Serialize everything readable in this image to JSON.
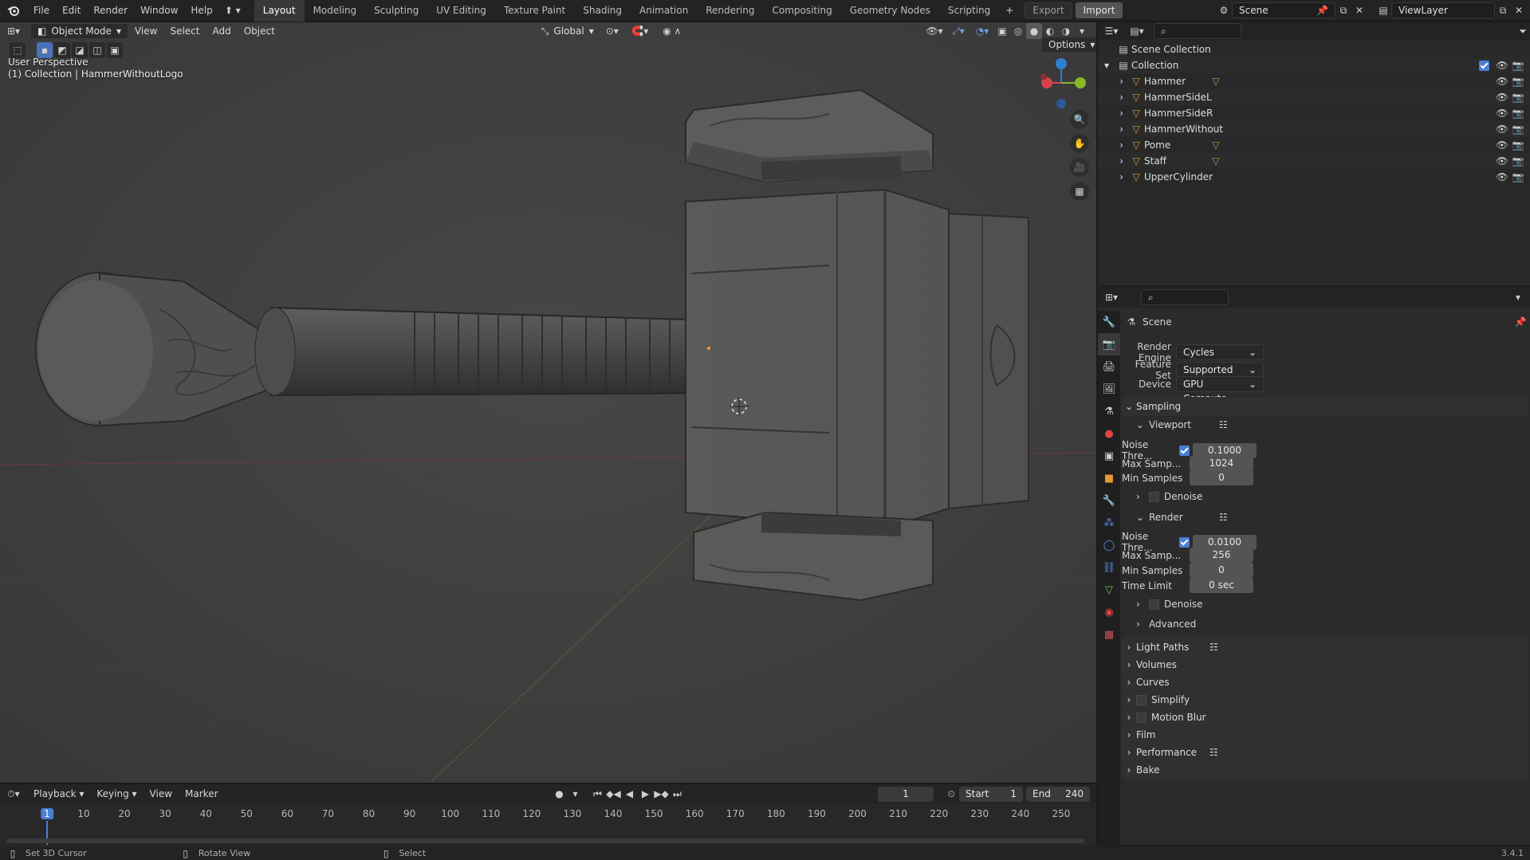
{
  "menu": {
    "file": "File",
    "edit": "Edit",
    "render": "Render",
    "window": "Window",
    "help": "Help"
  },
  "workspaces": [
    "Layout",
    "Modeling",
    "Sculpting",
    "UV Editing",
    "Texture Paint",
    "Shading",
    "Animation",
    "Rendering",
    "Compositing",
    "Geometry Nodes",
    "Scripting"
  ],
  "workspace_add": "+",
  "top_buttons": {
    "export": "Export",
    "import": "Import"
  },
  "scene": {
    "name": "Scene"
  },
  "view_layer": {
    "name": "ViewLayer"
  },
  "viewport": {
    "mode": "Object Mode",
    "menus": [
      "View",
      "Select",
      "Add",
      "Object"
    ],
    "transform_orientation": "Global",
    "options": "Options",
    "perspective": "User Perspective",
    "collection_info": "(1) Collection | HammerWithoutLogo",
    "gizmo": {
      "x_color": "#d7424e",
      "y_color": "#8ab728",
      "z_color": "#2f7fd1"
    }
  },
  "outliner": {
    "root": "Scene Collection",
    "collection": "Collection",
    "objects": [
      {
        "name": "Hammer",
        "has_mesh_data": true
      },
      {
        "name": "HammerSideL",
        "has_mesh_data": false
      },
      {
        "name": "HammerSideR",
        "has_mesh_data": false
      },
      {
        "name": "HammerWithout",
        "has_mesh_data": false
      },
      {
        "name": "Pome",
        "has_mesh_data": true
      },
      {
        "name": "Staff",
        "has_mesh_data": true
      },
      {
        "name": "UpperCylinder",
        "has_mesh_data": false
      }
    ]
  },
  "properties": {
    "context": "Scene",
    "render_engine": {
      "label": "Render Engine",
      "value": "Cycles"
    },
    "feature_set": {
      "label": "Feature Set",
      "value": "Supported"
    },
    "device": {
      "label": "Device",
      "value": "GPU Compute"
    },
    "sampling": {
      "title": "Sampling",
      "viewport": {
        "title": "Viewport",
        "noise_threshold": {
          "label": "Noise Thre...",
          "value": "0.1000",
          "enabled": true
        },
        "max_samples": {
          "label": "Max Samp...",
          "value": "1024"
        },
        "min_samples": {
          "label": "Min Samples",
          "value": "0"
        },
        "denoise": "Denoise"
      },
      "render": {
        "title": "Render",
        "noise_threshold": {
          "label": "Noise Thre...",
          "value": "0.0100",
          "enabled": true
        },
        "max_samples": {
          "label": "Max Samp...",
          "value": "256"
        },
        "min_samples": {
          "label": "Min Samples",
          "value": "0"
        },
        "time_limit": {
          "label": "Time Limit",
          "value": "0 sec"
        },
        "denoise": "Denoise"
      },
      "advanced": "Advanced"
    },
    "panels": [
      "Light Paths",
      "Volumes",
      "Curves",
      "Simplify",
      "Motion Blur",
      "Film",
      "Performance",
      "Bake"
    ]
  },
  "timeline": {
    "menus": [
      "Playback",
      "Keying",
      "View",
      "Marker"
    ],
    "current_frame": "1",
    "start_label": "Start",
    "start": "1",
    "end_label": "End",
    "end": "240",
    "ticks": [
      "1",
      "10",
      "20",
      "30",
      "40",
      "50",
      "60",
      "70",
      "80",
      "90",
      "100",
      "110",
      "120",
      "130",
      "140",
      "150",
      "160",
      "170",
      "180",
      "190",
      "200",
      "210",
      "220",
      "230",
      "240",
      "250"
    ]
  },
  "status": {
    "left": "Set 3D Cursor",
    "middle": "Rotate View",
    "right": "Select",
    "version": "3.4.1"
  }
}
